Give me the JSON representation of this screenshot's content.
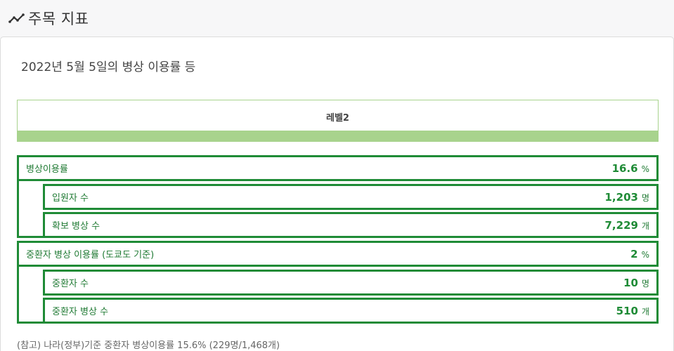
{
  "header": {
    "title": "주목 지표",
    "icon": "trend-line-icon"
  },
  "card": {
    "subtitle": "2022년 5월 5일의 병상 이용률 등",
    "level": {
      "label": "레벨2",
      "color": "#a8d38d"
    },
    "metrics": [
      {
        "label": "병상이용률",
        "value": "16.6",
        "unit": "%",
        "sub": [
          {
            "label": "입원자 수",
            "value": "1,203",
            "unit": "명"
          },
          {
            "label": "확보 병상 수",
            "value": "7,229",
            "unit": "개"
          }
        ]
      },
      {
        "label": "중환자 병상 이용률 (도쿄도 기준)",
        "value": "2",
        "unit": "%",
        "sub": [
          {
            "label": "중환자 수",
            "value": "10",
            "unit": "명"
          },
          {
            "label": "중환자 병상 수",
            "value": "510",
            "unit": "개"
          }
        ]
      }
    ],
    "footnote": "(참고) 나라(정부)기준 중환자 병상이용률 15.6% (229명/1,468개)"
  },
  "colors": {
    "accent_green": "#1f8b36",
    "level_green": "#a8d38d"
  }
}
